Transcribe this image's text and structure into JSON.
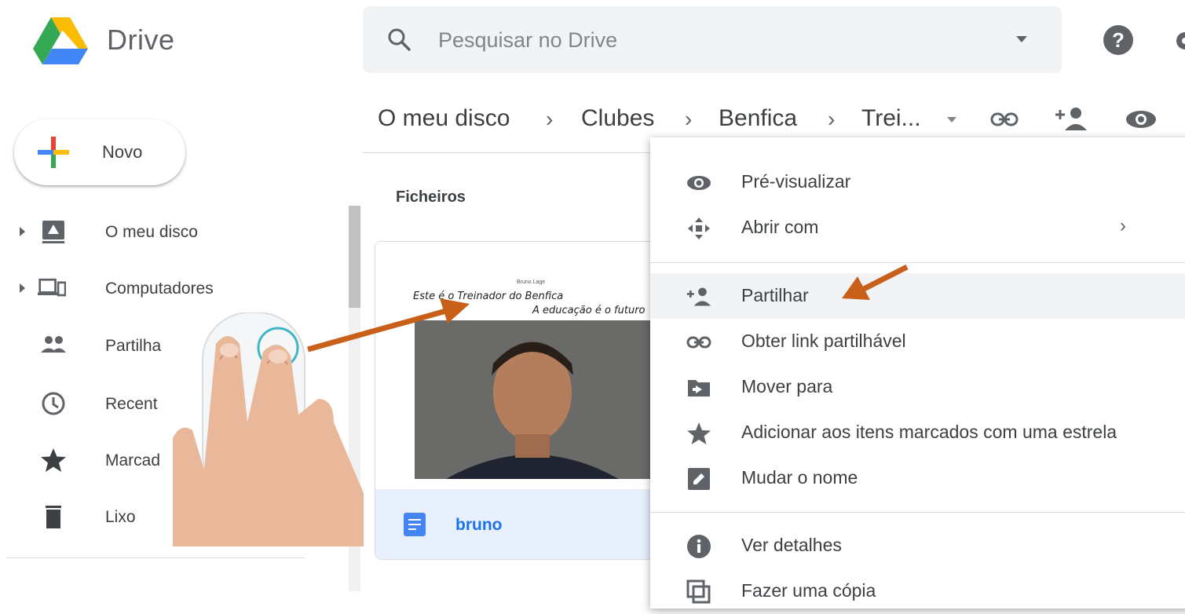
{
  "app": {
    "title": "Drive"
  },
  "search": {
    "placeholder": "Pesquisar no Drive"
  },
  "header": {
    "help_icon": "help-icon",
    "settings_icon": "gear-icon"
  },
  "new_button": {
    "label": "Novo"
  },
  "sidebar": {
    "items": [
      {
        "label": "O meu disco",
        "icon": "drive-icon",
        "expandable": true
      },
      {
        "label": "Computadores",
        "icon": "computers-icon",
        "expandable": true
      },
      {
        "label": "Partilha",
        "icon": "shared-icon",
        "expandable": false
      },
      {
        "label": "Recent",
        "icon": "clock-icon",
        "expandable": false
      },
      {
        "label": "Marcad",
        "icon": "star-icon",
        "expandable": false
      },
      {
        "label": "Lixo",
        "icon": "trash-icon",
        "expandable": false
      }
    ]
  },
  "breadcrumb": {
    "items": [
      "O meu disco",
      "Clubes",
      "Benfica",
      "Trei..."
    ],
    "separator": "›"
  },
  "toolbar": {
    "icons": [
      "link-icon",
      "add-person-icon",
      "eye-icon"
    ]
  },
  "main": {
    "section_label": "Ficheiros"
  },
  "file": {
    "name": "bruno",
    "thumb_small": "Bruno Lage",
    "thumb_line1": "Este é o Treinador do Benfica",
    "thumb_line2": "A educação é o futuro"
  },
  "context_menu": {
    "items": [
      {
        "label": "Pré-visualizar",
        "icon": "eye-icon"
      },
      {
        "label": "Abrir com",
        "icon": "open-with-icon",
        "submenu": "›"
      },
      {
        "label": "Partilhar",
        "icon": "add-person-icon",
        "highlighted": true
      },
      {
        "label": "Obter link partilhável",
        "icon": "link-icon"
      },
      {
        "label": "Mover para",
        "icon": "move-folder-icon"
      },
      {
        "label": "Adicionar aos itens marcados com uma estrela",
        "icon": "star-icon"
      },
      {
        "label": "Mudar o nome",
        "icon": "rename-icon"
      },
      {
        "label": "Ver detalhes",
        "icon": "info-icon"
      },
      {
        "label": "Fazer uma cópia",
        "icon": "copy-icon"
      }
    ]
  },
  "colors": {
    "accent": "#1a73e8",
    "annotation_arrow": "#c8601a",
    "highlight": "#f1f3f4"
  }
}
